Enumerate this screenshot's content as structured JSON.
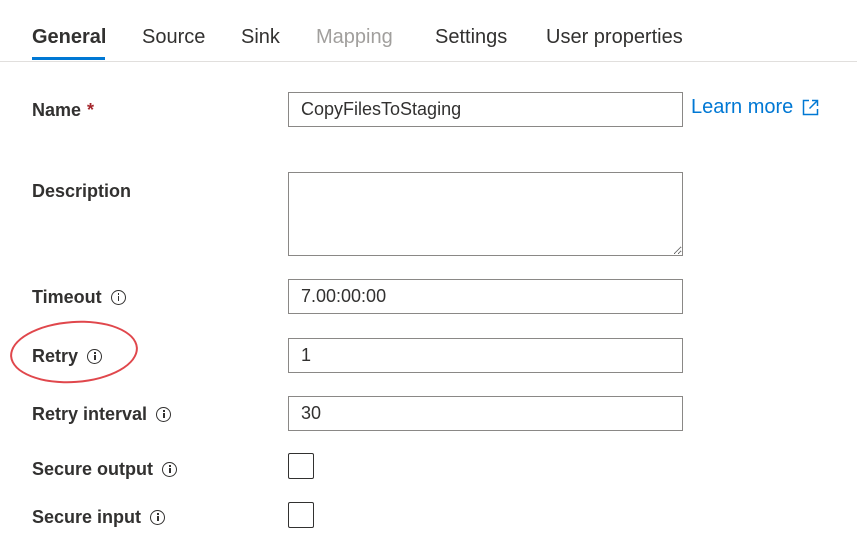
{
  "tabs": [
    {
      "label": "General",
      "state": "active"
    },
    {
      "label": "Source",
      "state": "normal"
    },
    {
      "label": "Sink",
      "state": "normal"
    },
    {
      "label": "Mapping",
      "state": "disabled"
    },
    {
      "label": "Settings",
      "state": "normal"
    },
    {
      "label": "User properties",
      "state": "normal"
    }
  ],
  "form": {
    "name": {
      "label": "Name",
      "required_marker": "*",
      "value": "CopyFilesToStaging"
    },
    "learn_more": {
      "label": "Learn more",
      "icon": "external-link-icon"
    },
    "description": {
      "label": "Description",
      "value": ""
    },
    "timeout": {
      "label": "Timeout",
      "value": "7.00:00:00",
      "icon": "info-icon"
    },
    "retry": {
      "label": "Retry",
      "value": "1",
      "icon": "info-icon"
    },
    "retry_interval": {
      "label": "Retry interval",
      "value": "30",
      "icon": "info-icon"
    },
    "secure_output": {
      "label": "Secure output",
      "checked": false,
      "icon": "info-icon"
    },
    "secure_input": {
      "label": "Secure input",
      "checked": false,
      "icon": "info-icon"
    }
  },
  "colors": {
    "accent": "#0078d4",
    "required": "#a4262c",
    "highlight": "#e0474c",
    "disabled_text": "#a19f9d"
  }
}
